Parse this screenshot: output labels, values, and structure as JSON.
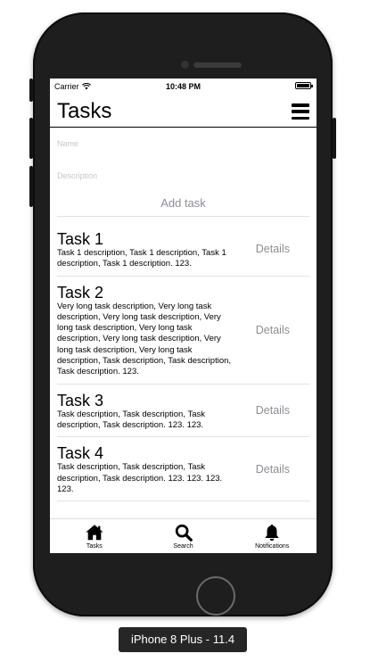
{
  "device_label": "iPhone 8 Plus - 11.4",
  "status_bar": {
    "carrier": "Carrier",
    "time": "10:48 PM"
  },
  "nav": {
    "title": "Tasks",
    "menu_icon": "hamburger-menu-icon"
  },
  "form": {
    "name_placeholder": "Name",
    "description_placeholder": "Description",
    "add_button": "Add task"
  },
  "tasks": [
    {
      "title": "Task 1",
      "description": "Task 1 description, Task 1 description, Task 1 description, Task 1 description. 123.",
      "details": "Details"
    },
    {
      "title": "Task 2",
      "description": "Very long task description, Very long task description, Very long task description, Very long task description, Very long task description, Very long task description, Very long task description, Very long task description, Task description, Task description, Task description. 123.",
      "details": "Details"
    },
    {
      "title": "Task 3",
      "description": "Task description, Task description, Task description, Task description. 123. 123.",
      "details": "Details"
    },
    {
      "title": "Task 4",
      "description": "Task description, Task description, Task description, Task description. 123. 123. 123. 123.",
      "details": "Details"
    }
  ],
  "tab_bar": [
    {
      "label": "Tasks",
      "icon": "home-icon"
    },
    {
      "label": "Search",
      "icon": "search-icon"
    },
    {
      "label": "Notifications",
      "icon": "bell-icon"
    }
  ]
}
